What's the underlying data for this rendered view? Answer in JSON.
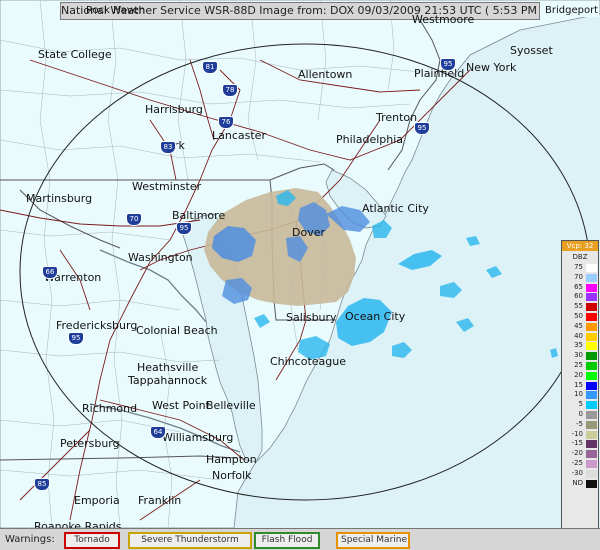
{
  "header": {
    "title": "National Weather Service WSR-88D Image from: DOX 09/03/2009 21:53 UTC ( 5:53 PM EDT)",
    "top_left_clipped": "Rock Haven",
    "top_right_clipped": "Bridgeport"
  },
  "colors": {
    "ocean": "#dcf2f6",
    "land": "#eafbfd",
    "county_lines": "#a3b3bd",
    "state_lines": "#555555",
    "roads": "#7a1a1a",
    "range_ring": "#222222",
    "radar_light": "#c8b89a",
    "radar_blue": "#4f8ee0",
    "radar_cyan": "#2ab7ee"
  },
  "cities": [
    {
      "name": "State College"
    },
    {
      "name": "Allentown"
    },
    {
      "name": "Plainfield"
    },
    {
      "name": "New York"
    },
    {
      "name": "Syosset"
    },
    {
      "name": "Westmoore"
    },
    {
      "name": "Harrisburg"
    },
    {
      "name": "Lancaster"
    },
    {
      "name": "Trenton"
    },
    {
      "name": "Philadelphia"
    },
    {
      "name": "York"
    },
    {
      "name": "Westminster"
    },
    {
      "name": "Martinsburg"
    },
    {
      "name": "Baltimore"
    },
    {
      "name": "Atlantic City"
    },
    {
      "name": "Dover"
    },
    {
      "name": "Washington"
    },
    {
      "name": "Warrenton"
    },
    {
      "name": "Fredericksburg"
    },
    {
      "name": "Colonial Beach"
    },
    {
      "name": "Salisbury"
    },
    {
      "name": "Ocean City"
    },
    {
      "name": "Chincoteague"
    },
    {
      "name": "Heathsville"
    },
    {
      "name": "Tappahannock"
    },
    {
      "name": "Richmond"
    },
    {
      "name": "West Point"
    },
    {
      "name": "Belleville"
    },
    {
      "name": "Williamsburg"
    },
    {
      "name": "Petersburg"
    },
    {
      "name": "Hampton"
    },
    {
      "name": "Norfolk"
    },
    {
      "name": "Emporia"
    },
    {
      "name": "Franklin"
    },
    {
      "name": "Roanoke Rapids"
    }
  ],
  "shields": [
    {
      "label": "81",
      "icon": "interstate-shield-icon"
    },
    {
      "label": "78",
      "icon": "interstate-shield-icon"
    },
    {
      "label": "76",
      "icon": "interstate-shield-icon"
    },
    {
      "label": "83",
      "icon": "interstate-shield-icon"
    },
    {
      "label": "95",
      "icon": "interstate-shield-icon"
    },
    {
      "label": "70",
      "icon": "interstate-shield-icon"
    },
    {
      "label": "95",
      "icon": "interstate-shield-icon"
    },
    {
      "label": "95",
      "icon": "interstate-shield-icon"
    },
    {
      "label": "95",
      "icon": "interstate-shield-icon"
    },
    {
      "label": "66",
      "icon": "interstate-shield-icon"
    },
    {
      "label": "64",
      "icon": "interstate-shield-icon"
    },
    {
      "label": "85",
      "icon": "interstate-shield-icon"
    }
  ],
  "legend": {
    "header": "Vcp: 32",
    "unit": "DBZ",
    "levels": [
      {
        "label": "75",
        "color": "#ffffff"
      },
      {
        "label": "70",
        "color": "#99ccff"
      },
      {
        "label": "65",
        "color": "#ff00ff"
      },
      {
        "label": "60",
        "color": "#9933ff"
      },
      {
        "label": "55",
        "color": "#cc0000"
      },
      {
        "label": "50",
        "color": "#ff0000"
      },
      {
        "label": "45",
        "color": "#ff9900"
      },
      {
        "label": "40",
        "color": "#ffcc00"
      },
      {
        "label": "35",
        "color": "#ffff00"
      },
      {
        "label": "30",
        "color": "#009900"
      },
      {
        "label": "25",
        "color": "#00cc00"
      },
      {
        "label": "20",
        "color": "#00ff00"
      },
      {
        "label": "15",
        "color": "#0000ff"
      },
      {
        "label": "10",
        "color": "#3399ff"
      },
      {
        "label": "5",
        "color": "#00ccff"
      },
      {
        "label": "0",
        "color": "#999999"
      },
      {
        "label": "-5",
        "color": "#99997a"
      },
      {
        "label": "-10",
        "color": "#cccc99"
      },
      {
        "label": "-15",
        "color": "#663366"
      },
      {
        "label": "-20",
        "color": "#996699"
      },
      {
        "label": "-25",
        "color": "#cc99cc"
      },
      {
        "label": "-30",
        "color": "#dddddd"
      },
      {
        "label": "ND",
        "color": "#111111"
      }
    ]
  },
  "warnings": {
    "label": "Warnings:",
    "items": [
      {
        "label": "Tornado",
        "color": "#cc0000"
      },
      {
        "label": "Severe Thunderstorm",
        "color": "#c8a400"
      },
      {
        "label": "Flash Flood",
        "color": "#2f8a2f"
      },
      {
        "label": "Special Marine",
        "color": "#e89000"
      }
    ]
  }
}
